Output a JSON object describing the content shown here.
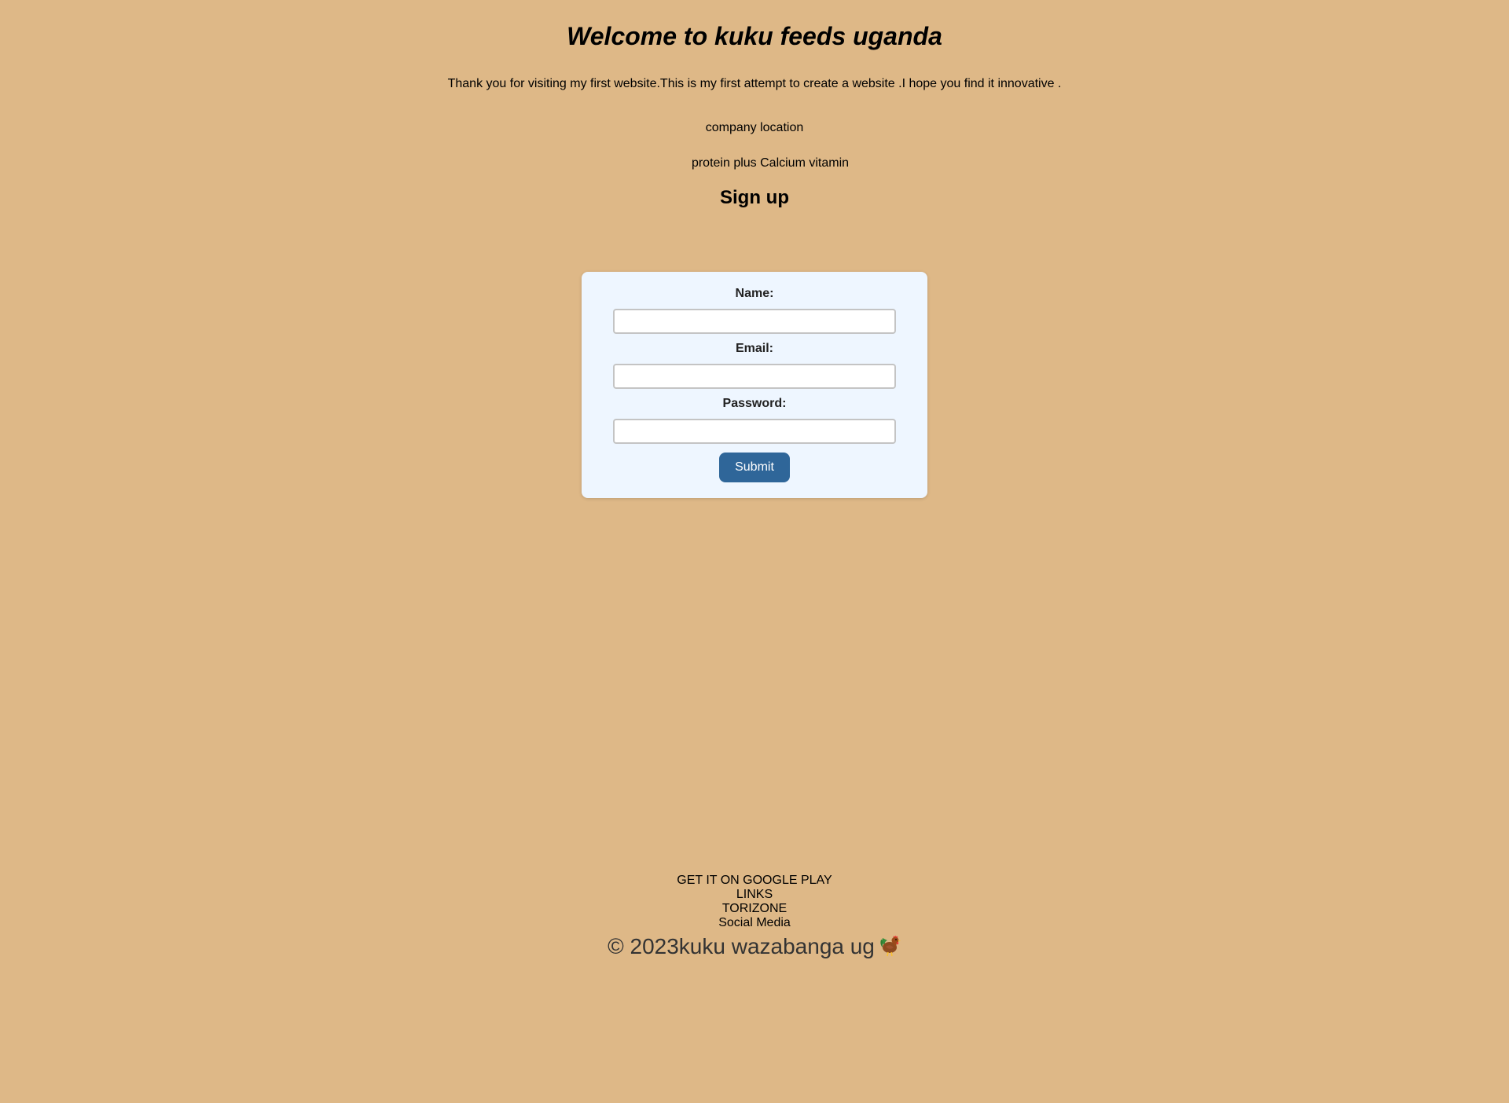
{
  "header": {
    "title": "Welcome to kuku feeds uganda",
    "intro": "Thank you for visiting my first website.This is my first attempt to create a website .I hope you find it innovative ."
  },
  "info": {
    "location": "company location",
    "products": "protein plus Calcium vitamin"
  },
  "signup": {
    "heading": "Sign up",
    "name_label": "Name:",
    "name_value": "",
    "email_label": "Email:",
    "email_value": "",
    "password_label": "Password:",
    "password_value": "",
    "submit_label": "Submit"
  },
  "footer": {
    "links": [
      "GET IT ON GOOGLE PLAY",
      "LINKS",
      "TORIZONE",
      "Social Media"
    ],
    "copyright": "© 2023kuku wazabanga ug",
    "copyright_icon": "rooster-icon"
  },
  "colors": {
    "background": "#deb887",
    "card": "#eef6ff",
    "button": "#2f6699"
  }
}
